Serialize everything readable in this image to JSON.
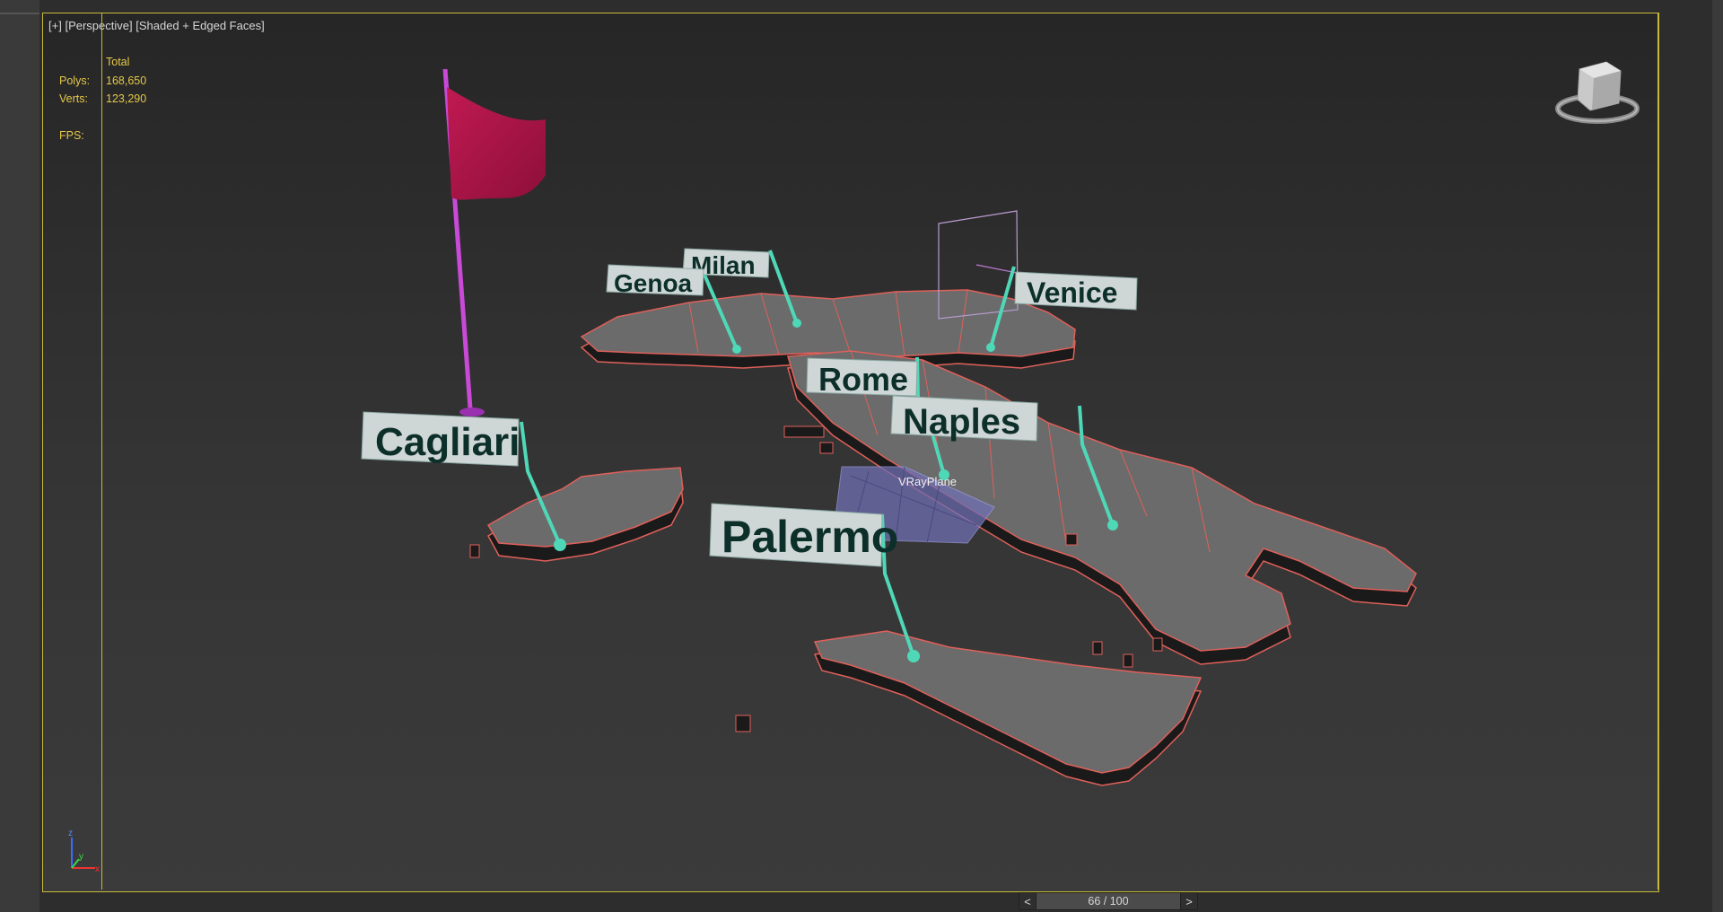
{
  "viewport": {
    "menu_plus": "[+]",
    "view_mode": "[Perspective]",
    "shading_mode": "[Shaded + Edged Faces]"
  },
  "stats": {
    "header": "Total",
    "polys_label": "Polys:",
    "polys_value": "168,650",
    "verts_label": "Verts:",
    "verts_value": "123,290",
    "fps_label": "FPS:"
  },
  "scene": {
    "city_labels": [
      "Milan",
      "Genoa",
      "Venice",
      "Rome",
      "Naples",
      "Cagliari",
      "Palermo"
    ],
    "vray_plane_label": "VRayPlane",
    "colors": {
      "region_fill": "#6b6b6b",
      "region_edge": "#e0605a",
      "extrusion": "#1a1a1a",
      "leader": "#4fd8b7",
      "flag": "#b2154a",
      "pole": "#c84ad6",
      "label_panel": "#cfd7d6",
      "label_text": "#0d2f2a"
    }
  },
  "axis": {
    "z": "z",
    "y": "y",
    "x": "x"
  },
  "timeline": {
    "prev": "<",
    "position": "66 / 100",
    "next": ">"
  }
}
